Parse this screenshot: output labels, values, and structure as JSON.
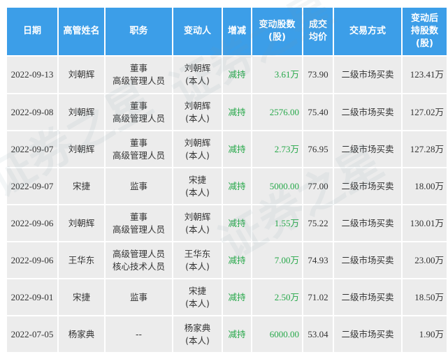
{
  "headers": {
    "date": [
      "日期"
    ],
    "name": [
      "高管姓名"
    ],
    "position": [
      "职务"
    ],
    "changer": [
      "变动人"
    ],
    "direction": [
      "增减"
    ],
    "quantity": [
      "变动股数",
      "(股)"
    ],
    "price": [
      "成交",
      "均价"
    ],
    "mode": [
      "交易方式"
    ],
    "holding": [
      "变动后",
      "持股数",
      "(股)"
    ]
  },
  "rows": [
    {
      "date": "2022-09-13",
      "name": "刘朝辉",
      "position": [
        "董事",
        "高级管理人员"
      ],
      "changer": [
        "刘朝辉",
        "(本人)"
      ],
      "direction": "减持",
      "quantity": "3.61",
      "quantity_unit": "万",
      "price": "73.90",
      "mode": "二级市场买卖",
      "holding": "123.41",
      "holding_unit": "万"
    },
    {
      "date": "2022-09-08",
      "name": "刘朝辉",
      "position": [
        "董事",
        "高级管理人员"
      ],
      "changer": [
        "刘朝辉",
        "(本人)"
      ],
      "direction": "减持",
      "quantity": "2576.00",
      "quantity_unit": "",
      "price": "75.40",
      "mode": "二级市场买卖",
      "holding": "127.02",
      "holding_unit": "万"
    },
    {
      "date": "2022-09-07",
      "name": "刘朝辉",
      "position": [
        "董事",
        "高级管理人员"
      ],
      "changer": [
        "刘朝辉",
        "(本人)"
      ],
      "direction": "减持",
      "quantity": "2.73",
      "quantity_unit": "万",
      "price": "76.95",
      "mode": "二级市场买卖",
      "holding": "127.28",
      "holding_unit": "万"
    },
    {
      "date": "2022-09-07",
      "name": "宋捷",
      "position": [
        "监事"
      ],
      "changer": [
        "宋捷",
        "(本人)"
      ],
      "direction": "减持",
      "quantity": "5000.00",
      "quantity_unit": "",
      "price": "77.00",
      "mode": "二级市场买卖",
      "holding": "18.00",
      "holding_unit": "万"
    },
    {
      "date": "2022-09-06",
      "name": "刘朝辉",
      "position": [
        "董事",
        "高级管理人员"
      ],
      "changer": [
        "刘朝辉",
        "(本人)"
      ],
      "direction": "减持",
      "quantity": "1.55",
      "quantity_unit": "万",
      "price": "75.22",
      "mode": "二级市场买卖",
      "holding": "130.01",
      "holding_unit": "万"
    },
    {
      "date": "2022-09-06",
      "name": "王华东",
      "position": [
        "高级管理人员",
        "核心技术人员"
      ],
      "changer": [
        "王华东",
        "(本人)"
      ],
      "direction": "减持",
      "quantity": "7.00",
      "quantity_unit": "万",
      "price": "74.93",
      "mode": "二级市场买卖",
      "holding": "23.00",
      "holding_unit": "万"
    },
    {
      "date": "2022-09-01",
      "name": "宋捷",
      "position": [
        "监事"
      ],
      "changer": [
        "宋捷",
        "(本人)"
      ],
      "direction": "减持",
      "quantity": "2.50",
      "quantity_unit": "万",
      "price": "71.02",
      "mode": "二级市场买卖",
      "holding": "18.50",
      "holding_unit": "万"
    },
    {
      "date": "2022-07-05",
      "name": "杨家典",
      "position": [
        "--"
      ],
      "changer": [
        "杨家典",
        "(本人)"
      ],
      "direction": "减持",
      "quantity": "6000.00",
      "quantity_unit": "",
      "price": "53.04",
      "mode": "二级市场买卖",
      "holding": "1.90",
      "holding_unit": "万"
    }
  ],
  "watermark": "证券之星",
  "colors": {
    "header_bg": "#3c9ee8",
    "cell_bg": "#ececec",
    "decrease_text": "#27a84a"
  }
}
